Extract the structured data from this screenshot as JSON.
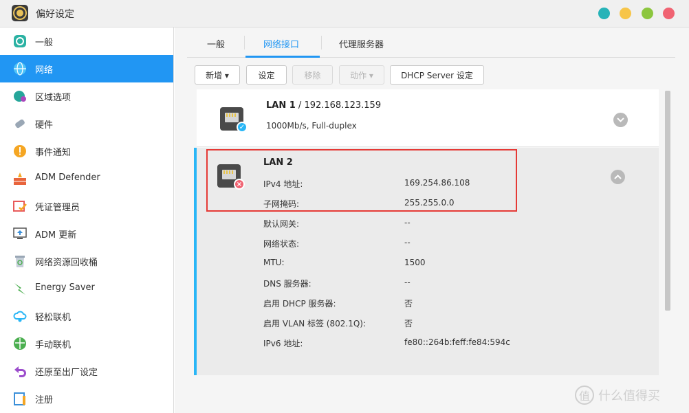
{
  "window": {
    "title": "偏好设定"
  },
  "colors": {
    "accent": "#2196f3",
    "highlight": "#e53935",
    "ok": "#29b6f6",
    "error": "#f06372"
  },
  "traffic_lights": [
    {
      "name": "teal",
      "color": "#26b3b8"
    },
    {
      "name": "yellow",
      "color": "#f7c548"
    },
    {
      "name": "green",
      "color": "#8cc63e"
    },
    {
      "name": "red",
      "color": "#f06372"
    }
  ],
  "sidebar": {
    "items": [
      {
        "label": "一般",
        "icon": "general-icon",
        "color": "#2bb2a3"
      },
      {
        "label": "网络",
        "icon": "globe-icon",
        "color": "#29b6f6",
        "active": true
      },
      {
        "label": "区域选项",
        "icon": "region-icon",
        "color": "#26a69a"
      },
      {
        "label": "硬件",
        "icon": "hardware-icon",
        "color": "#9aa7b5"
      },
      {
        "label": "事件通知",
        "icon": "notification-icon",
        "color": "#f5a623"
      },
      {
        "label": "ADM Defender",
        "icon": "defender-icon",
        "color": "#e8643c"
      },
      {
        "label": "凭证管理员",
        "icon": "certificate-icon",
        "color": "#e85a5a"
      },
      {
        "label": "ADM 更新",
        "icon": "update-icon",
        "color": "#3a8fd9"
      },
      {
        "label": "网络资源回收桶",
        "icon": "recycle-bin-icon",
        "color": "#9aa7b5"
      },
      {
        "label": "Energy Saver",
        "icon": "energy-icon",
        "color": "#4caf50"
      },
      {
        "label": "轻松联机",
        "icon": "cloud-connect-icon",
        "color": "#29b6f6"
      },
      {
        "label": "手动联机",
        "icon": "manual-connect-icon",
        "color": "#4caf50"
      },
      {
        "label": "还原至出厂设定",
        "icon": "restore-icon",
        "color": "#9c4dcc"
      },
      {
        "label": "注册",
        "icon": "register-icon",
        "color": "#3a8fd9"
      }
    ]
  },
  "tabs": [
    {
      "label": "一般"
    },
    {
      "label": "网络接口",
      "active": true
    },
    {
      "label": "代理服务器"
    }
  ],
  "toolbar": {
    "add": "新增 ▾",
    "settings": "设定",
    "remove": "移除",
    "action": "动作 ▾",
    "dhcp": "DHCP Server 设定"
  },
  "interfaces": [
    {
      "name": "LAN 1",
      "ip_suffix": " / 192.168.123.159",
      "detail": "1000Mb/s, Full-duplex",
      "status": "connected"
    },
    {
      "name": "LAN 2",
      "status": "disconnected",
      "details": [
        {
          "label": "IPv4 地址:",
          "value": "169.254.86.108"
        },
        {
          "label": "子网掩码:",
          "value": "255.255.0.0"
        },
        {
          "label": "默认网关:",
          "value": "--"
        },
        {
          "label": "网络状态:",
          "value": "--"
        },
        {
          "label": "MTU:",
          "value": "1500"
        },
        {
          "label": "DNS 服务器:",
          "value": "--"
        },
        {
          "label": "启用 DHCP 服务器:",
          "value": "否"
        },
        {
          "label": "启用 VLAN 标签 (802.1Q):",
          "value": "否"
        },
        {
          "label": "IPv6 地址:",
          "value": "fe80::264b:feff:fe84:594c"
        }
      ]
    }
  ],
  "watermark": {
    "text": "什么值得买",
    "symbol": "值"
  }
}
